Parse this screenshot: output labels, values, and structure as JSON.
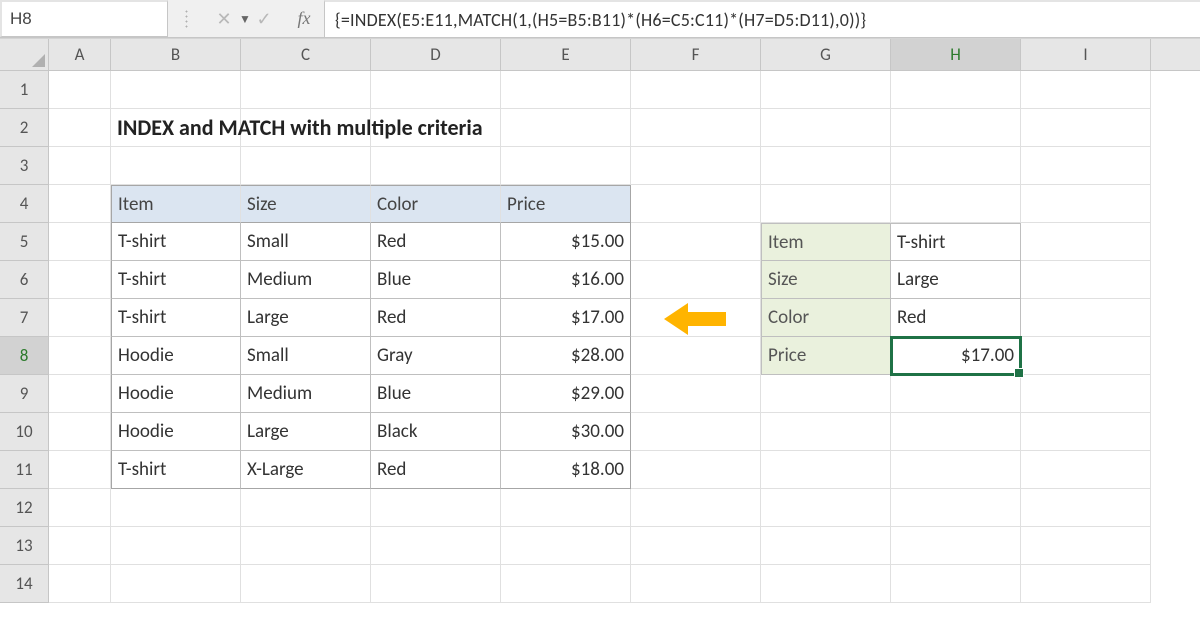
{
  "name_box": "H8",
  "formula": "{=INDEX(E5:E11,MATCH(1,(H5=B5:B11)*(H6=C5:C11)*(H7=D5:D11),0))}",
  "columns": [
    "A",
    "B",
    "C",
    "D",
    "E",
    "F",
    "G",
    "H",
    "I"
  ],
  "rows": [
    "1",
    "2",
    "3",
    "4",
    "5",
    "6",
    "7",
    "8",
    "9",
    "10",
    "11",
    "12",
    "13",
    "14"
  ],
  "title": "INDEX and MATCH with multiple criteria",
  "active": {
    "col": "H",
    "row": "8"
  },
  "table": {
    "headers": {
      "item": "Item",
      "size": "Size",
      "color": "Color",
      "price": "Price"
    },
    "rows": [
      {
        "item": "T-shirt",
        "size": "Small",
        "color": "Red",
        "price": "$15.00"
      },
      {
        "item": "T-shirt",
        "size": "Medium",
        "color": "Blue",
        "price": "$16.00"
      },
      {
        "item": "T-shirt",
        "size": "Large",
        "color": "Red",
        "price": "$17.00"
      },
      {
        "item": "Hoodie",
        "size": "Small",
        "color": "Gray",
        "price": "$28.00"
      },
      {
        "item": "Hoodie",
        "size": "Medium",
        "color": "Blue",
        "price": "$29.00"
      },
      {
        "item": "Hoodie",
        "size": "Large",
        "color": "Black",
        "price": "$30.00"
      },
      {
        "item": "T-shirt",
        "size": "X-Large",
        "color": "Red",
        "price": "$18.00"
      }
    ]
  },
  "lookup": {
    "item_label": "Item",
    "item_value": "T-shirt",
    "size_label": "Size",
    "size_value": "Large",
    "color_label": "Color",
    "color_value": "Red",
    "price_label": "Price",
    "price_value": "$17.00"
  },
  "colors": {
    "accent": "#1f7246",
    "header_bg": "#dbe5f1",
    "lookup_bg": "#eaf1dd",
    "arrow": "#ffb400"
  }
}
